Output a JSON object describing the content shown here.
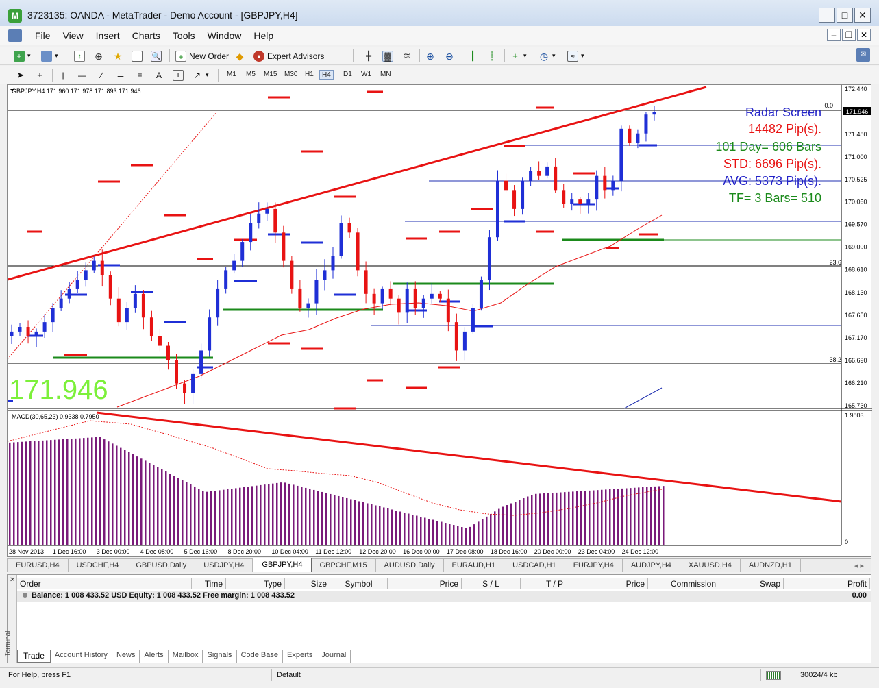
{
  "window": {
    "title": "3723135: OANDA - MetaTrader - Demo Account - [GBPJPY,H4]",
    "app_icon": "metatrader-icon"
  },
  "menu": [
    "File",
    "View",
    "Insert",
    "Charts",
    "Tools",
    "Window",
    "Help"
  ],
  "toolbar": {
    "new_order": "New Order",
    "expert_advisors": "Expert Advisors"
  },
  "timeframes": [
    "M1",
    "M5",
    "M15",
    "M30",
    "H1",
    "H4",
    "D1",
    "W1",
    "MN"
  ],
  "active_timeframe": "H4",
  "chart": {
    "header": "GBPJPY,H4  171.960 171.978 171.893 171.946",
    "big_price": "171.946",
    "current_price_tag": "171.946",
    "level_0": "0.0",
    "level_236": "23.6",
    "level_382": "38.2",
    "radar": {
      "title": "Radar Screen",
      "pips": "14482 Pip(s).",
      "days": "101 Day= 606 Bars",
      "std": "STD: 6696 Pip(s).",
      "avg": "AVG: 5373 Pip(s).",
      "tf": "TF= 3 Bars= 510"
    },
    "macd_header": "MACD(30,65,23) 0.9338 0.7950",
    "macd_max": "1.9803",
    "macd_zero": "0",
    "colors": {
      "bull": "#1f2fd6",
      "bear": "#e81313",
      "trend": "#e81313",
      "pivot_green": "#1b8a1b",
      "radar_blue": "#2424c8",
      "radar_red": "#e81313",
      "radar_green": "#1b8a1b",
      "big_price": "#7cf03a",
      "macd": "#7a1a7a"
    }
  },
  "chart_data": {
    "type": "candlestick",
    "symbol": "GBPJPY",
    "timeframe": "H4",
    "y_ticks": [
      "172.440",
      "171.480",
      "171.000",
      "170.525",
      "170.050",
      "169.570",
      "169.090",
      "168.610",
      "168.130",
      "167.650",
      "167.170",
      "166.690",
      "166.210",
      "165.730"
    ],
    "x_ticks": [
      "28 Nov 2013",
      "1 Dec 16:00",
      "3 Dec 00:00",
      "4 Dec 08:00",
      "5 Dec 16:00",
      "8 Dec 20:00",
      "10 Dec 04:00",
      "11 Dec 12:00",
      "12 Dec 20:00",
      "16 Dec 00:00",
      "17 Dec 08:00",
      "18 Dec 16:00",
      "20 Dec 00:00",
      "23 Dec 04:00",
      "24 Dec 12:00"
    ],
    "ylim": [
      165.73,
      172.44
    ],
    "close_path": [
      167.3,
      167.4,
      167.2,
      167.3,
      167.5,
      167.8,
      168.0,
      168.2,
      168.4,
      168.6,
      168.8,
      168.5,
      168.0,
      167.5,
      167.8,
      168.1,
      167.6,
      167.2,
      167.0,
      166.7,
      166.2,
      166.0,
      166.4,
      166.9,
      167.6,
      168.2,
      168.6,
      168.8,
      169.2,
      169.6,
      169.8,
      169.9,
      169.4,
      168.8,
      168.2,
      167.8,
      167.9,
      168.4,
      168.6,
      168.9,
      169.6,
      169.4,
      168.6,
      168.1,
      167.9,
      168.2,
      168.0,
      167.7,
      168.2,
      167.8,
      168.0,
      168.1,
      168.0,
      167.5,
      166.9,
      167.3,
      167.8,
      168.4,
      169.3,
      170.5,
      170.3,
      169.9,
      170.5,
      170.7,
      170.6,
      170.8,
      170.3,
      170.0,
      170.1,
      170.0,
      170.1,
      170.6,
      170.3,
      170.5,
      171.6,
      171.3,
      171.5,
      171.9,
      171.95
    ]
  },
  "symbol_tabs": [
    "EURUSD,H4",
    "USDCHF,H4",
    "GBPUSD,Daily",
    "USDJPY,H4",
    "GBPJPY,H4",
    "GBPCHF,M15",
    "AUDUSD,Daily",
    "EURAUD,H1",
    "USDCAD,H1",
    "EURJPY,H4",
    "AUDJPY,H4",
    "XAUUSD,H4",
    "AUDNZD,H1"
  ],
  "active_symbol_tab": "GBPJPY,H4",
  "terminal": {
    "label": "Terminal",
    "columns": [
      "Order",
      "Time",
      "Type",
      "Size",
      "Symbol",
      "Price",
      "S / L",
      "T / P",
      "Price",
      "Commission",
      "Swap",
      "Profit"
    ],
    "balance": "Balance: 1 008 433.52 USD  Equity: 1 008 433.52  Free margin: 1 008 433.52",
    "profit": "0.00",
    "tabs": [
      "Trade",
      "Account History",
      "News",
      "Alerts",
      "Mailbox",
      "Signals",
      "Code Base",
      "Experts",
      "Journal"
    ]
  },
  "status": {
    "help": "For Help, press F1",
    "profile": "Default",
    "traffic": "30024/4 kb"
  }
}
